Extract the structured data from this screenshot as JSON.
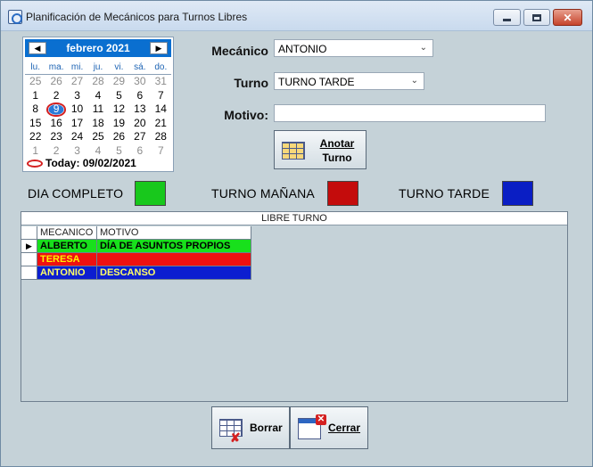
{
  "window": {
    "title": "Planificación de Mecánicos para Turnos Libres",
    "controls": {
      "minimize": "minimize-icon",
      "maximize": "maximize-icon",
      "close": "✕"
    }
  },
  "calendar": {
    "month_label": "febrero 2021",
    "prev": "◀",
    "next": "▶",
    "weekdays": [
      "lu.",
      "ma.",
      "mi.",
      "ju.",
      "vi.",
      "sá.",
      "do."
    ],
    "weeks": [
      [
        {
          "d": "25",
          "o": true
        },
        {
          "d": "26",
          "o": true
        },
        {
          "d": "27",
          "o": true
        },
        {
          "d": "28",
          "o": true
        },
        {
          "d": "29",
          "o": true
        },
        {
          "d": "30",
          "o": true
        },
        {
          "d": "31",
          "o": true
        }
      ],
      [
        {
          "d": "1"
        },
        {
          "d": "2"
        },
        {
          "d": "3"
        },
        {
          "d": "4"
        },
        {
          "d": "5"
        },
        {
          "d": "6"
        },
        {
          "d": "7"
        }
      ],
      [
        {
          "d": "8"
        },
        {
          "d": "9",
          "t": true
        },
        {
          "d": "10"
        },
        {
          "d": "11"
        },
        {
          "d": "12"
        },
        {
          "d": "13"
        },
        {
          "d": "14"
        }
      ],
      [
        {
          "d": "15"
        },
        {
          "d": "16"
        },
        {
          "d": "17"
        },
        {
          "d": "18"
        },
        {
          "d": "19"
        },
        {
          "d": "20"
        },
        {
          "d": "21"
        }
      ],
      [
        {
          "d": "22"
        },
        {
          "d": "23"
        },
        {
          "d": "24"
        },
        {
          "d": "25"
        },
        {
          "d": "26"
        },
        {
          "d": "27"
        },
        {
          "d": "28"
        }
      ],
      [
        {
          "d": "1",
          "o": true
        },
        {
          "d": "2",
          "o": true
        },
        {
          "d": "3",
          "o": true
        },
        {
          "d": "4",
          "o": true
        },
        {
          "d": "5",
          "o": true
        },
        {
          "d": "6",
          "o": true
        },
        {
          "d": "7",
          "o": true
        }
      ]
    ],
    "today_text": "Today: 09/02/2021"
  },
  "form": {
    "mecanico_label": "Mecánico",
    "mecanico_value": "ANTONIO",
    "turno_label": "Turno",
    "turno_value": "TURNO TARDE",
    "motivo_label": "Motivo:",
    "motivo_value": "",
    "anotar_label_line1": "Anotar",
    "anotar_label_line2": "Turno"
  },
  "legend": [
    {
      "label": "DIA COMPLETO",
      "color": "#18c81c"
    },
    {
      "label": "TURNO MAÑANA",
      "color": "#c40c0c"
    },
    {
      "label": "TURNO TARDE",
      "color": "#0a1ec4"
    }
  ],
  "table": {
    "caption": "LIBRE TURNO",
    "headers": [
      "MECANICO",
      "MOTIVO"
    ],
    "rows": [
      {
        "mecanico": "ALBERTO",
        "motivo": "DÍA DE ASUNTOS PROPIOS",
        "style": "r-green",
        "current": true
      },
      {
        "mecanico": "TERESA",
        "motivo": "",
        "style": "r-red",
        "current": false
      },
      {
        "mecanico": "ANTONIO",
        "motivo": "DESCANSO",
        "style": "r-blue",
        "current": false
      }
    ],
    "row_indicator": "▶"
  },
  "buttons": {
    "borrar_label": "Borrar",
    "cerrar_label": "Cerrar"
  }
}
